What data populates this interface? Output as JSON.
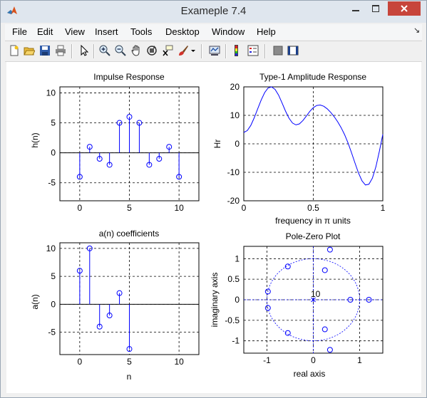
{
  "window": {
    "title": "Exameple 7.4"
  },
  "menu": [
    "File",
    "Edit",
    "View",
    "Insert",
    "Tools",
    "Desktop",
    "Window",
    "Help"
  ],
  "toolbar_icons": [
    "new-figure-icon",
    "open-file-icon",
    "save-icon",
    "print-icon",
    "edit-plot-icon",
    "zoom-in-icon",
    "zoom-out-icon",
    "pan-icon",
    "rotate-3d-icon",
    "data-cursor-icon",
    "brush-icon",
    "brush-dropdown-icon",
    "link-plot-icon",
    "insert-colorbar-icon",
    "insert-legend-icon",
    "hide-plot-tools-icon",
    "show-plot-tools-icon"
  ],
  "plots": {
    "impulse": {
      "title": "Impulse Response",
      "xlabel": "n",
      "ylabel": "h(n)"
    },
    "amplitude": {
      "title": "Type-1 Amplitude Response",
      "xlabel": "frequency in π units",
      "ylabel": "Hr"
    },
    "coeffs": {
      "title": "a(n) coefficients",
      "xlabel": "n",
      "ylabel": "a(n)"
    },
    "polezero": {
      "title": "Pole-Zero Plot",
      "xlabel": "real axis",
      "ylabel": "imaginary axis",
      "pole_label": "10"
    }
  },
  "chart_data": [
    {
      "type": "stem",
      "title": "Impulse Response",
      "xlabel": "n",
      "ylabel": "h(n)",
      "xlim": [
        -2,
        12
      ],
      "ylim": [
        -8,
        11
      ],
      "xticks": [
        0,
        5,
        10
      ],
      "yticks": [
        10,
        5,
        0,
        -5
      ],
      "x": [
        0,
        1,
        2,
        3,
        4,
        5,
        6,
        7,
        8,
        9,
        10
      ],
      "values": [
        -4,
        1,
        -1,
        -2,
        5,
        6,
        5,
        -2,
        -1,
        1,
        -4
      ],
      "grid": true
    },
    {
      "type": "line",
      "title": "Type-1 Amplitude Response",
      "xlabel": "frequency in π units",
      "ylabel": "Hr",
      "xlim": [
        0,
        1
      ],
      "ylim": [
        -20,
        20
      ],
      "xticks": [
        0,
        0.5,
        1
      ],
      "yticks": [
        20,
        10,
        0,
        -10,
        -20
      ],
      "x": [
        0,
        0.025,
        0.05,
        0.075,
        0.1,
        0.125,
        0.15,
        0.175,
        0.2,
        0.225,
        0.25,
        0.275,
        0.3,
        0.325,
        0.35,
        0.375,
        0.4,
        0.425,
        0.45,
        0.475,
        0.5,
        0.525,
        0.55,
        0.575,
        0.6,
        0.625,
        0.65,
        0.675,
        0.7,
        0.725,
        0.75,
        0.775,
        0.8,
        0.825,
        0.85,
        0.875,
        0.9,
        0.925,
        0.95,
        0.975,
        1.0
      ],
      "y": [
        4.0,
        4.64,
        6.44,
        9.13,
        12.29,
        15.41,
        18.0,
        19.62,
        20.0,
        19.1,
        17.1,
        14.39,
        11.51,
        9.01,
        7.31,
        6.65,
        7.01,
        8.17,
        9.77,
        11.4,
        12.71,
        13.48,
        13.63,
        13.2,
        12.29,
        11.04,
        9.53,
        7.77,
        5.7,
        3.22,
        0.27,
        -3.12,
        -6.76,
        -10.24,
        -12.99,
        -14.45,
        -14.2,
        -12.04,
        -8.08,
        -2.73,
        3.32
      ],
      "grid": true
    },
    {
      "type": "stem",
      "title": "a(n) coefficients",
      "xlabel": "n",
      "ylabel": "a(n)",
      "xlim": [
        -2,
        12
      ],
      "ylim": [
        -9,
        11
      ],
      "xticks": [
        0,
        5,
        10
      ],
      "yticks": [
        10,
        5,
        0,
        -5
      ],
      "x": [
        0,
        1,
        2,
        3,
        4,
        5
      ],
      "values": [
        6,
        10,
        -4,
        -2,
        2,
        -8
      ],
      "grid": true
    },
    {
      "type": "scatter",
      "title": "Pole-Zero Plot",
      "xlabel": "real axis",
      "ylabel": "imaginary axis",
      "xlim": [
        -1.5,
        1.5
      ],
      "ylim": [
        -1.3,
        1.3
      ],
      "xticks": [
        -1,
        0,
        1
      ],
      "yticks": [
        1,
        0.5,
        0,
        -0.5,
        -1
      ],
      "zeros": [
        [
          0.36,
          1.22
        ],
        [
          0.36,
          -1.22
        ],
        [
          -0.55,
          0.81
        ],
        [
          -0.55,
          -0.81
        ],
        [
          0.25,
          0.72
        ],
        [
          0.25,
          -0.72
        ],
        [
          -0.98,
          0.2
        ],
        [
          -0.98,
          -0.2
        ],
        [
          0.8,
          0
        ],
        [
          1.2,
          0
        ]
      ],
      "poles": [
        [
          0,
          0
        ]
      ],
      "pole_multiplicity": "10",
      "unit_circle": true,
      "grid": true
    }
  ]
}
